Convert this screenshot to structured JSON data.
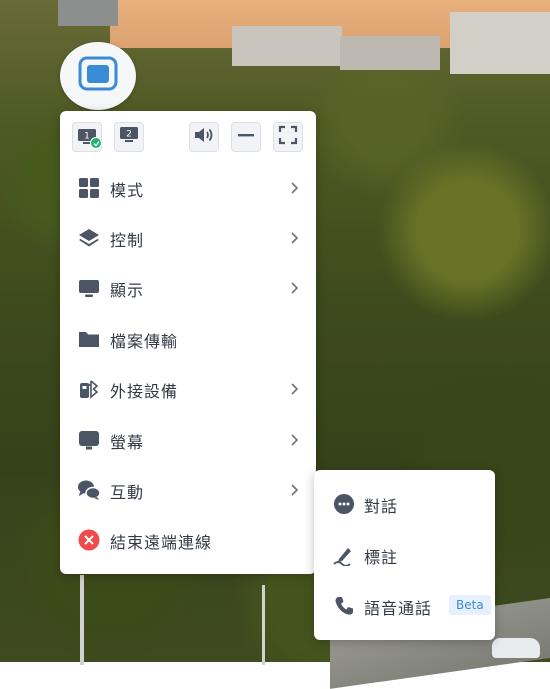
{
  "toolbar": {
    "monitor1_label": "1",
    "monitor2_label": "2",
    "icons": [
      "monitor-1-icon",
      "monitor-2-icon",
      "volume-icon",
      "minimize-icon",
      "fullscreen-icon"
    ]
  },
  "menu": {
    "items": [
      {
        "label": "模式",
        "icon": "grid-icon",
        "has_submenu": true
      },
      {
        "label": "控制",
        "icon": "layers-icon",
        "has_submenu": true
      },
      {
        "label": "顯示",
        "icon": "display-icon",
        "has_submenu": true
      },
      {
        "label": "檔案傳輸",
        "icon": "folder-icon",
        "has_submenu": false
      },
      {
        "label": "外接設備",
        "icon": "usb-bluetooth-icon",
        "has_submenu": true
      },
      {
        "label": "螢幕",
        "icon": "screen-icon",
        "has_submenu": true
      },
      {
        "label": "互動",
        "icon": "chat-icon",
        "has_submenu": true
      },
      {
        "label": "結束遠端連線",
        "icon": "close-circle-icon",
        "has_submenu": false
      }
    ]
  },
  "submenu": {
    "items": [
      {
        "label": "對話",
        "icon": "message-icon"
      },
      {
        "label": "標註",
        "icon": "annotate-icon"
      },
      {
        "label": "語音通話",
        "icon": "phone-icon",
        "badge": "Beta"
      }
    ]
  },
  "colors": {
    "accent": "#3a8bd6",
    "icon": "#4b5563",
    "danger": "#ef4b4b",
    "success": "#22b36b",
    "text": "#333a45"
  }
}
